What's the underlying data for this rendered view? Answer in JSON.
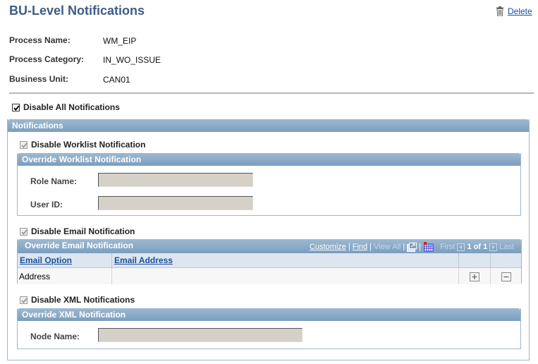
{
  "page": {
    "title": "BU-Level Notifications",
    "delete_label": "Delete"
  },
  "info": [
    {
      "label": "Process Name:",
      "value": "WM_EIP"
    },
    {
      "label": "Process Category:",
      "value": "IN_WO_ISSUE"
    },
    {
      "label": "Business Unit:",
      "value": "CAN01"
    }
  ],
  "disable_all": {
    "label": "Disable All Notifications",
    "checked": true
  },
  "notifications": {
    "title": "Notifications",
    "worklist": {
      "checkbox_label": "Disable Worklist Notification",
      "checked": true,
      "override_title": "Override Worklist Notification",
      "role_name_label": "Role Name:",
      "role_name_value": "",
      "user_id_label": "User ID:",
      "user_id_value": ""
    },
    "email": {
      "checkbox_label": "Disable Email Notification",
      "checked": true,
      "override_title": "Override Email Notification",
      "nav": {
        "customize": "Customize",
        "find": "Find",
        "view_all": "View All",
        "first": "First",
        "count": "1 of 1",
        "last": "Last"
      },
      "columns": [
        "Email Option",
        "Email Address"
      ],
      "rows": [
        {
          "email_option": "Address",
          "email_address": ""
        }
      ]
    },
    "xml": {
      "checkbox_label": "Disable XML Notifications",
      "checked": true,
      "override_title": "Override XML Notification",
      "node_name_label": "Node Name:",
      "node_name_value": ""
    }
  },
  "colors": {
    "title": "#3e5c85",
    "panel_header": "#7b9ebf",
    "field_bg": "#d5d0c8",
    "link": "#1a4fa0"
  }
}
